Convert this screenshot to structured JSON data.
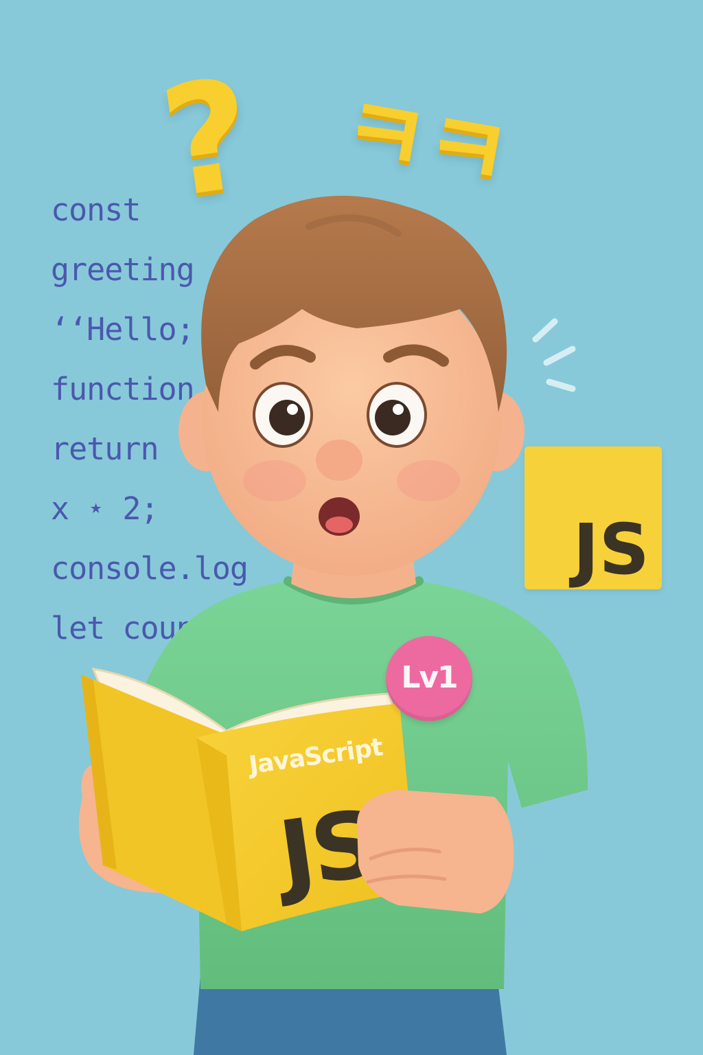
{
  "code_lines": [
    "const",
    "greeting",
    "‘‘Hello;",
    "function",
    "return",
    "x ⋆ 2;",
    "console.log",
    "let count"
  ],
  "reactions": {
    "question_mark": "?",
    "laugh_text": "ㅋㅋ"
  },
  "js_badge_label": "JS",
  "book": {
    "title": "JavaScript",
    "logo": "JS"
  },
  "level_pin": "Lv1",
  "colors": {
    "background": "#87c9d9",
    "code_text": "#4a58ad",
    "accent_yellow": "#f8cf2e",
    "shirt": "#72cc8a",
    "pin": "#ec6aa0"
  }
}
